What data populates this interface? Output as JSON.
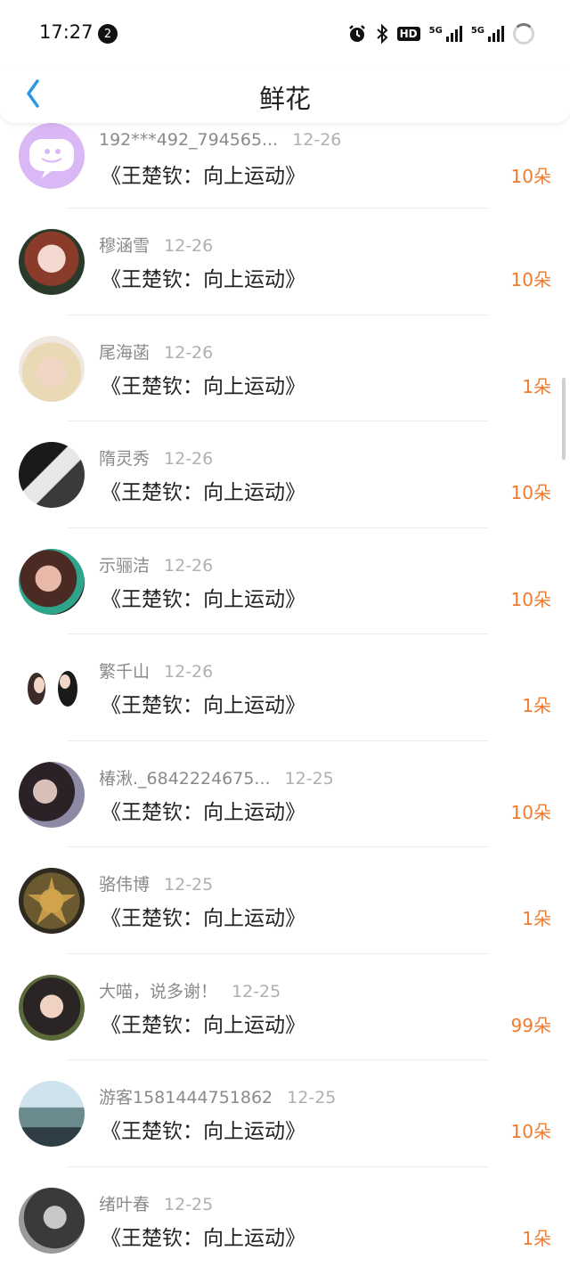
{
  "status_bar": {
    "time": "17:27",
    "notification_count": "2",
    "hd_label": "HD",
    "signal_label_1": "5G",
    "signal_label_2": "5G"
  },
  "header": {
    "title": "鲜花"
  },
  "theme": {
    "accent": "#f07a2e",
    "back_color": "#2a98e8"
  },
  "rows": [
    {
      "name": "192***492_794565...",
      "date": "12-26",
      "work": "《王楚钦：向上运动》",
      "amount": "10朵"
    },
    {
      "name": "穆涵雪",
      "date": "12-26",
      "work": "《王楚钦：向上运动》",
      "amount": "10朵"
    },
    {
      "name": "尾海菡",
      "date": "12-26",
      "work": "《王楚钦：向上运动》",
      "amount": "1朵"
    },
    {
      "name": "隋灵秀",
      "date": "12-26",
      "work": "《王楚钦：向上运动》",
      "amount": "10朵"
    },
    {
      "name": "示骊洁",
      "date": "12-26",
      "work": "《王楚钦：向上运动》",
      "amount": "10朵"
    },
    {
      "name": "繁千山",
      "date": "12-26",
      "work": "《王楚钦：向上运动》",
      "amount": "1朵"
    },
    {
      "name": "椿湫._6842224675...",
      "date": "12-25",
      "work": "《王楚钦：向上运动》",
      "amount": "10朵"
    },
    {
      "name": "骆伟博",
      "date": "12-25",
      "work": "《王楚钦：向上运动》",
      "amount": "1朵"
    },
    {
      "name": "大喵，说多谢！",
      "date": "12-25",
      "work": "《王楚钦：向上运动》",
      "amount": "99朵"
    },
    {
      "name": "游客1581444751862",
      "date": "12-25",
      "work": "《王楚钦：向上运动》",
      "amount": "10朵"
    },
    {
      "name": "绪叶春",
      "date": "12-25",
      "work": "《王楚钦：向上运动》",
      "amount": "1朵"
    }
  ]
}
